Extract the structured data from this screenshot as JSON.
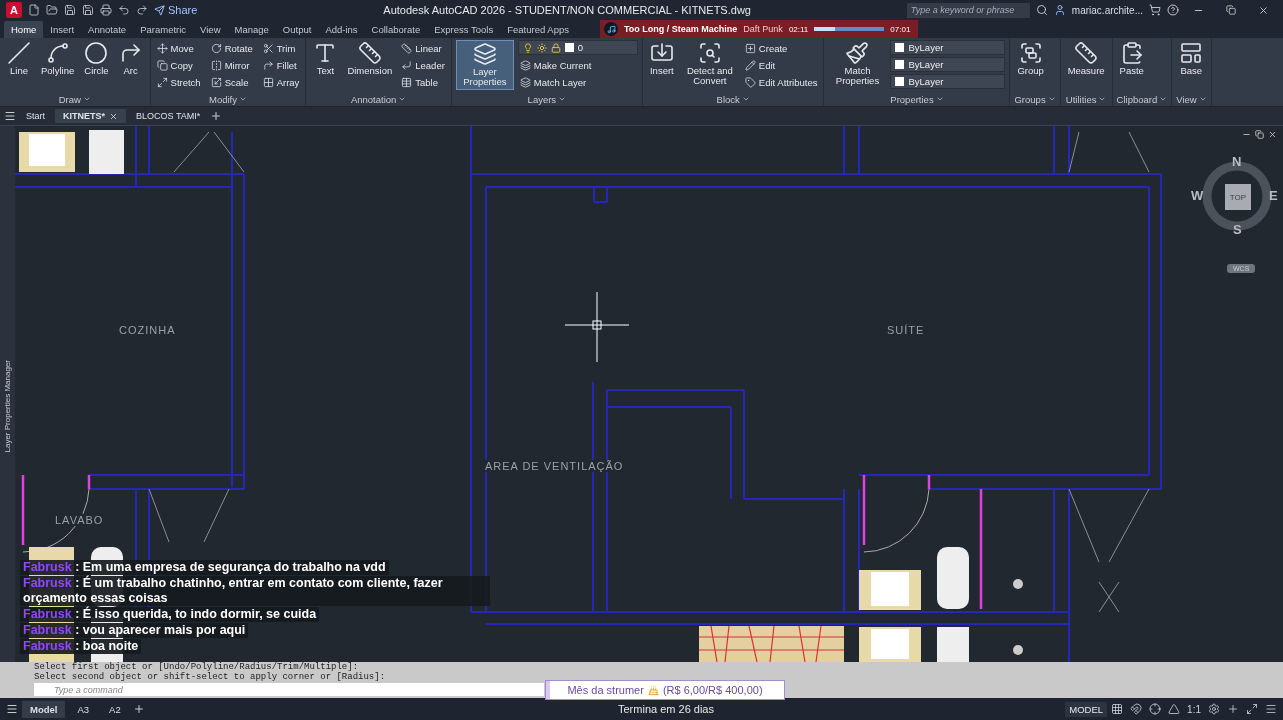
{
  "title_bar": {
    "app_letter": "A",
    "share": "Share",
    "title": "Autodesk AutoCAD 2026 - STUDENT/NON COMMERCIAL - KITNETS.dwg",
    "search": {
      "placeholder": "Type a keyword or phrase"
    },
    "user": "mariac.archite..."
  },
  "now_playing": {
    "song": "Too Long / Steam Machine",
    "artist": "Daft Punk",
    "elapsed": "02:11",
    "total": "07:01",
    "level": 0.3
  },
  "ribbon_tabs": [
    {
      "label": "Home",
      "selected": true
    },
    {
      "label": "Insert",
      "selected": false
    },
    {
      "label": "Annotate",
      "selected": false
    },
    {
      "label": "Parametric",
      "selected": false
    },
    {
      "label": "View",
      "selected": false
    },
    {
      "label": "Manage",
      "selected": false
    },
    {
      "label": "Output",
      "selected": false
    },
    {
      "label": "Add-ins",
      "selected": false
    },
    {
      "label": "Collaborate",
      "selected": false
    },
    {
      "label": "Express Tools",
      "selected": false
    },
    {
      "label": "Featured Apps",
      "selected": false
    }
  ],
  "ribbon_panels": [
    {
      "title": "Draw",
      "tools": [
        {
          "kind": "large",
          "label": "Line"
        },
        {
          "kind": "large",
          "label": "Polyline"
        },
        {
          "kind": "large",
          "label": "Circle"
        },
        {
          "kind": "large",
          "label": "Arc"
        }
      ]
    },
    {
      "title": "Modify",
      "tools": [
        {
          "kind": "small",
          "label": "Move"
        },
        {
          "kind": "small",
          "label": "Copy"
        },
        {
          "kind": "small",
          "label": "Stretch"
        },
        {
          "kind": "small",
          "label": "Rotate"
        },
        {
          "kind": "small",
          "label": "Mirror"
        },
        {
          "kind": "small",
          "label": "Scale"
        },
        {
          "kind": "small",
          "label": "Trim"
        },
        {
          "kind": "small",
          "label": "Fillet"
        },
        {
          "kind": "small",
          "label": "Array"
        }
      ]
    },
    {
      "title": "Annotation",
      "tools": [
        {
          "kind": "large",
          "label": "Text"
        },
        {
          "kind": "large",
          "label": "Dimension"
        },
        {
          "kind": "small",
          "label": "Linear"
        },
        {
          "kind": "small",
          "label": "Leader"
        },
        {
          "kind": "small",
          "label": "Table"
        }
      ]
    },
    {
      "title": "Layers",
      "tools": [
        {
          "kind": "large",
          "label": "Layer Properties"
        },
        {
          "kind": "dropdown",
          "label": "0"
        },
        {
          "kind": "small",
          "label": "Make Current"
        },
        {
          "kind": "small",
          "label": "Match Layer"
        }
      ]
    },
    {
      "title": "Block",
      "tools": [
        {
          "kind": "large",
          "label": "Insert"
        },
        {
          "kind": "large",
          "label": "Detect and Convert"
        },
        {
          "kind": "small",
          "label": "Create"
        },
        {
          "kind": "small",
          "label": "Edit"
        },
        {
          "kind": "small",
          "label": "Edit Attributes"
        }
      ]
    },
    {
      "title": "Properties",
      "tools": [
        {
          "kind": "large",
          "label": "Match Properties"
        },
        {
          "kind": "dropdown",
          "label": "ByLayer"
        },
        {
          "kind": "dropdown",
          "label": "ByLayer"
        },
        {
          "kind": "dropdown",
          "label": "ByLayer"
        }
      ]
    },
    {
      "title": "Groups",
      "tools": [
        {
          "kind": "large",
          "label": "Group"
        }
      ]
    },
    {
      "title": "Utilities",
      "tools": [
        {
          "kind": "large",
          "label": "Measure"
        }
      ]
    },
    {
      "title": "Clipboard",
      "tools": [
        {
          "kind": "large",
          "label": "Paste"
        }
      ]
    },
    {
      "title": "View",
      "tools": [
        {
          "kind": "large",
          "label": "Base"
        }
      ]
    }
  ],
  "document_tabs": [
    {
      "label": "Start",
      "selected": false,
      "closable": false
    },
    {
      "label": "KITNETS*",
      "selected": true,
      "closable": true
    },
    {
      "label": "BLOCOS TAMI*",
      "selected": false,
      "closable": false
    }
  ],
  "side_palette": {
    "label": "Layer Properties Manager"
  },
  "drawing": {
    "rooms": [
      "COZINHA",
      "SUÍTE",
      "AREA DE VENTILAÇÃO",
      "LAVABO"
    ]
  },
  "view_cube": {
    "north": "N",
    "south": "S",
    "east": "E",
    "west": "W",
    "face": "TOP",
    "ucs": "WCS"
  },
  "chat": [
    {
      "user": "Fabrusk",
      "text": ": Em uma empresa de segurança do trabalho na vdd"
    },
    {
      "user": "Fabrusk",
      "text": ": É um trabalho chatinho, entrar em contato com cliente, fazer orçamento essas coisas"
    },
    {
      "user": "Fabrusk",
      "text": ": É isso querida, to indo dormir, se cuida"
    },
    {
      "user": "Fabrusk",
      "text": ": vou aparecer mais por aqui"
    },
    {
      "user": "Fabrusk",
      "text": ": boa noite"
    }
  ],
  "command_line": {
    "history": [
      "Select first object or [Undo/Polyline/Radius/Trim/Multiple]:",
      "Select second object or shift-select to apply corner or [Radius]:"
    ],
    "placeholder": "Type a command"
  },
  "goal": {
    "label": "Mês da strumer",
    "amount": "(R$ 6,00/R$ 400,00)",
    "ends": "Termina em 26 dias",
    "level": 0.015
  },
  "layout_tabs": [
    {
      "label": "Model",
      "selected": true
    },
    {
      "label": "A3",
      "selected": false
    },
    {
      "label": "A2",
      "selected": false
    }
  ],
  "status_bar": {
    "space": "MODEL",
    "scale": "1:1"
  }
}
